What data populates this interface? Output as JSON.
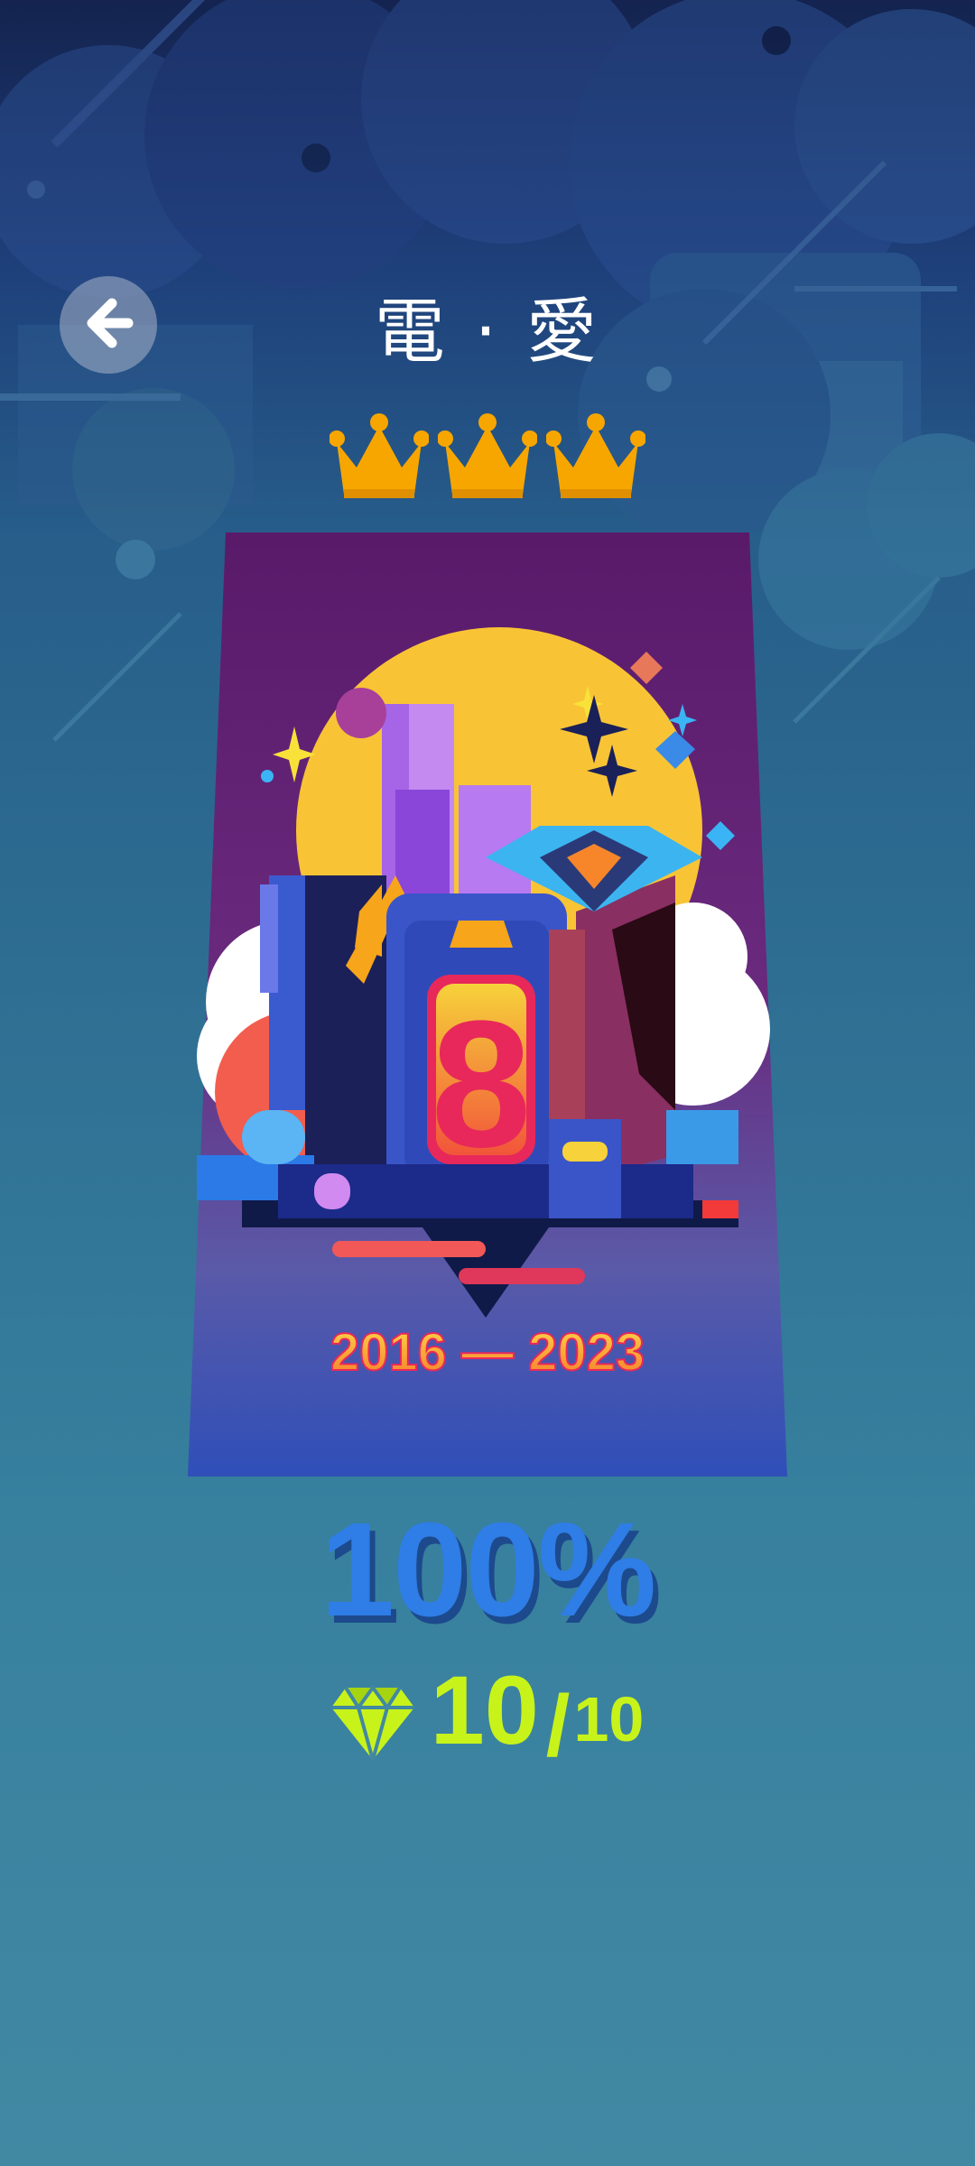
{
  "header": {
    "title": "電 · 愛",
    "back_icon": "arrow-left-icon"
  },
  "rating": {
    "crowns": 3,
    "crown_color": "#f7a600"
  },
  "poster": {
    "badge_number": "8",
    "years": "2016 — 2023"
  },
  "result": {
    "percent": "100%",
    "gems_collected": "10",
    "gems_separator": "/",
    "gems_total": "10",
    "gem_icon": "diamond-icon",
    "percent_color": "#2f7de6",
    "gem_color": "#c8f31a"
  }
}
